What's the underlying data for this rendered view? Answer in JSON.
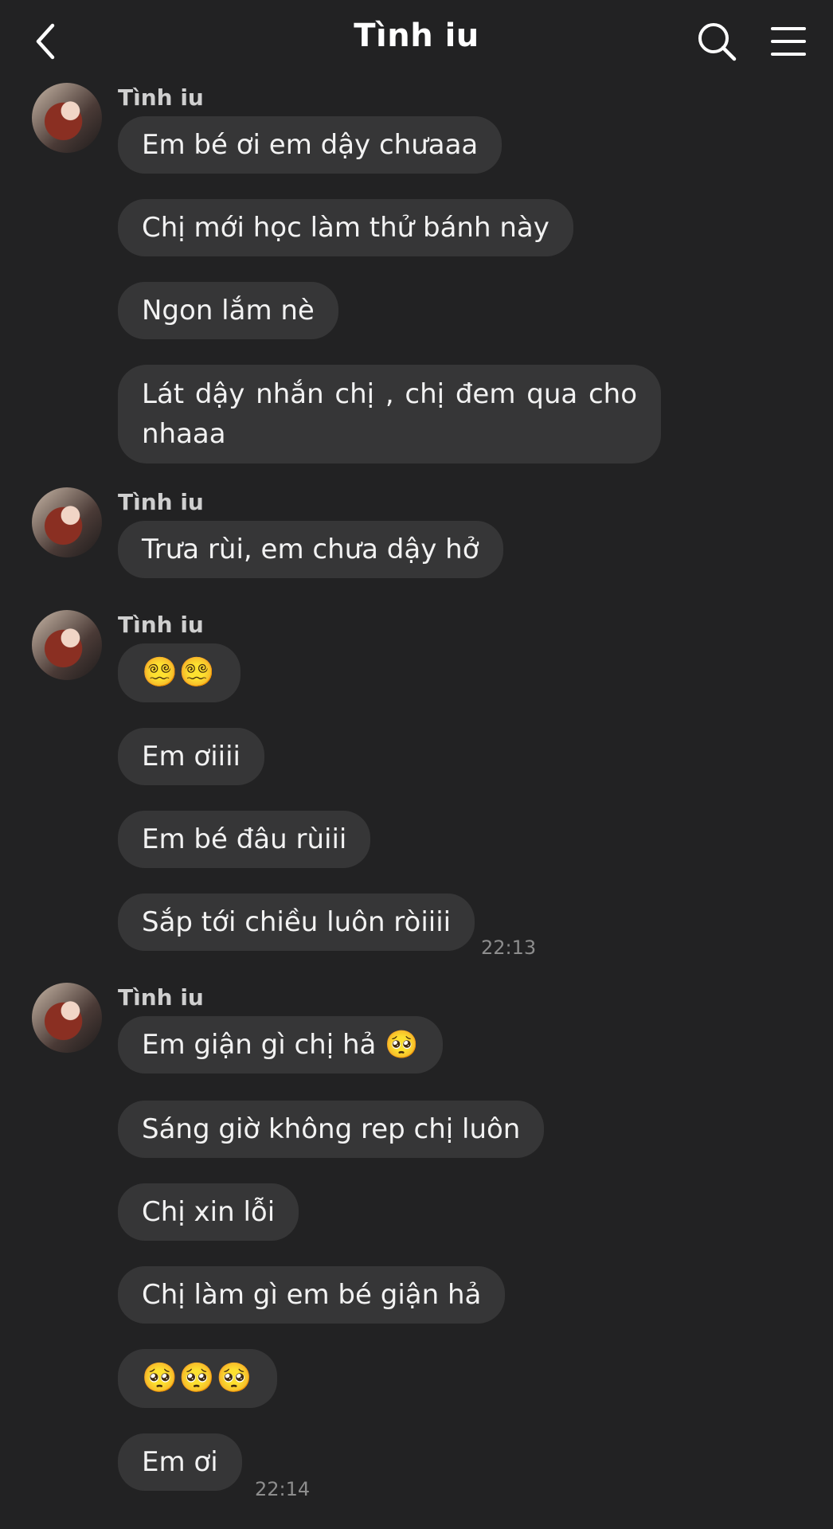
{
  "header": {
    "title": "Tình iu",
    "back_icon": "chevron-left-icon",
    "search_icon": "search-icon",
    "menu_icon": "hamburger-menu-icon"
  },
  "groups": [
    {
      "sender": "Tình iu",
      "messages": [
        "Em bé ơi em dậy chưaaa",
        "Chị mới học làm thử bánh này",
        "Ngon lắm nè",
        "Lát dậy nhắn chị , chị đem qua cho nhaaa"
      ]
    },
    {
      "sender": "Tình iu",
      "messages": [
        "Trưa rùi, em chưa dậy hở"
      ]
    },
    {
      "sender": "Tình iu",
      "messages": [
        "😵‍💫😵‍💫",
        "Em ơiiii",
        "Em bé đâu rùiii",
        "Sắp tới chiều luôn ròiiii"
      ],
      "time": "22:13"
    },
    {
      "sender": "Tình iu",
      "messages": [
        "Em giận gì chị hả 🥺",
        "Sáng giờ không rep chị luôn",
        "Chị xin lỗi",
        "Chị làm gì em bé giận hả",
        "🥺🥺🥺",
        "Em ơi"
      ],
      "time": "22:14"
    }
  ],
  "colors": {
    "background": "#222223",
    "bubble": "#363637",
    "text": "#f2f2f2",
    "timestamp": "#8d8d8d"
  }
}
